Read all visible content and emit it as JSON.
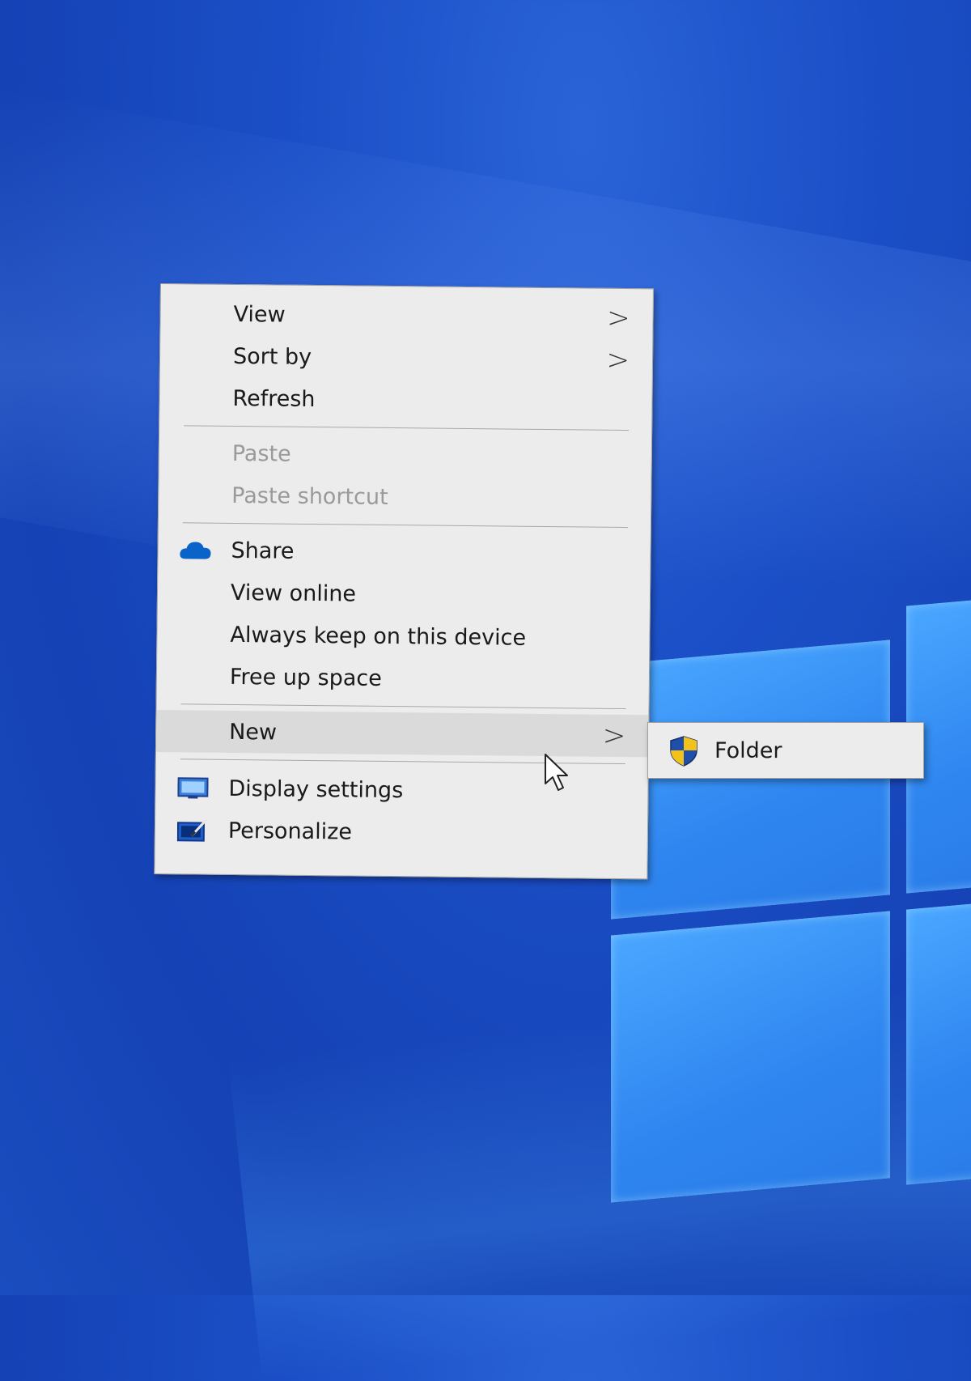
{
  "context_menu": {
    "items": [
      {
        "label": "View",
        "submenu": true
      },
      {
        "label": "Sort by",
        "submenu": true
      },
      {
        "label": "Refresh"
      },
      {
        "label": "Paste",
        "disabled": true
      },
      {
        "label": "Paste shortcut",
        "disabled": true
      },
      {
        "label": "Share",
        "icon": "onedrive-cloud-icon"
      },
      {
        "label": "View online"
      },
      {
        "label": "Always keep on this device"
      },
      {
        "label": "Free up space"
      },
      {
        "label": "New",
        "submenu": true,
        "highlighted": true
      },
      {
        "label": "Display settings",
        "icon": "display-settings-icon"
      },
      {
        "label": "Personalize",
        "icon": "personalize-icon"
      }
    ],
    "chevron": ">"
  },
  "new_submenu": {
    "items": [
      {
        "label": "Folder",
        "icon": "uac-shield-icon"
      }
    ]
  },
  "colors": {
    "desktop_blue": "#1b4fc7",
    "menu_background": "#ececec",
    "disabled_text": "#9a9a9a",
    "onedrive_blue": "#0a63c9"
  }
}
